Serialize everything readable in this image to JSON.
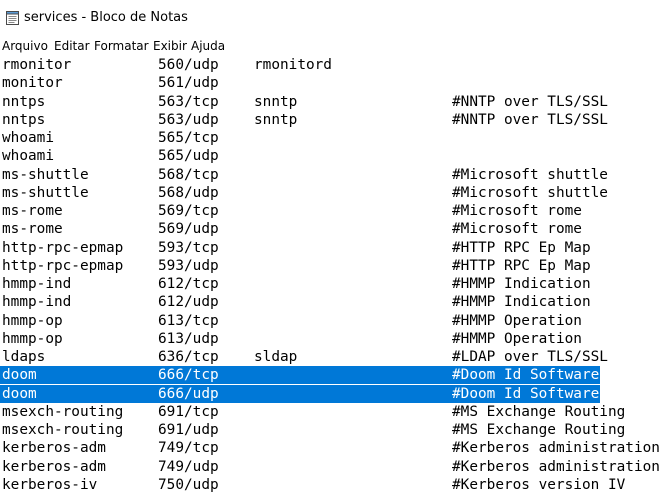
{
  "window": {
    "title": "services - Bloco de Notas"
  },
  "menu": [
    "Arquivo",
    "Editar",
    "Formatar",
    "Exibir",
    "Ajuda"
  ],
  "lines": [
    {
      "name": "rmonitor",
      "port": "560/udp",
      "alias": "rmonitord",
      "comment": ""
    },
    {
      "name": "monitor",
      "port": "561/udp",
      "alias": "",
      "comment": ""
    },
    {
      "name": "nntps",
      "port": "563/tcp",
      "alias": "snntp",
      "comment": "#NNTP over TLS/SSL"
    },
    {
      "name": "nntps",
      "port": "563/udp",
      "alias": "snntp",
      "comment": "#NNTP over TLS/SSL"
    },
    {
      "name": "whoami",
      "port": "565/tcp",
      "alias": "",
      "comment": ""
    },
    {
      "name": "whoami",
      "port": "565/udp",
      "alias": "",
      "comment": ""
    },
    {
      "name": "ms-shuttle",
      "port": "568/tcp",
      "alias": "",
      "comment": "#Microsoft shuttle"
    },
    {
      "name": "ms-shuttle",
      "port": "568/udp",
      "alias": "",
      "comment": "#Microsoft shuttle"
    },
    {
      "name": "ms-rome",
      "port": "569/tcp",
      "alias": "",
      "comment": "#Microsoft rome"
    },
    {
      "name": "ms-rome",
      "port": "569/udp",
      "alias": "",
      "comment": "#Microsoft rome"
    },
    {
      "name": "http-rpc-epmap",
      "port": "593/tcp",
      "alias": "",
      "comment": "#HTTP RPC Ep Map"
    },
    {
      "name": "http-rpc-epmap",
      "port": "593/udp",
      "alias": "",
      "comment": "#HTTP RPC Ep Map"
    },
    {
      "name": "hmmp-ind",
      "port": "612/tcp",
      "alias": "",
      "comment": "#HMMP Indication"
    },
    {
      "name": "hmmp-ind",
      "port": "612/udp",
      "alias": "",
      "comment": "#HMMP Indication"
    },
    {
      "name": "hmmp-op",
      "port": "613/tcp",
      "alias": "",
      "comment": "#HMMP Operation"
    },
    {
      "name": "hmmp-op",
      "port": "613/udp",
      "alias": "",
      "comment": "#HMMP Operation"
    },
    {
      "name": "ldaps",
      "port": "636/tcp",
      "alias": "sldap",
      "comment": "#LDAP over TLS/SSL"
    },
    {
      "name": "doom",
      "port": "666/tcp",
      "alias": "",
      "comment": "#Doom Id Software",
      "selected": true
    },
    {
      "name": "doom",
      "port": "666/udp",
      "alias": "",
      "comment": "#Doom Id Software",
      "selected": true
    },
    {
      "name": "msexch-routing",
      "port": "691/tcp",
      "alias": "",
      "comment": "#MS Exchange Routing"
    },
    {
      "name": "msexch-routing",
      "port": "691/udp",
      "alias": "",
      "comment": "#MS Exchange Routing"
    },
    {
      "name": "kerberos-adm",
      "port": "749/tcp",
      "alias": "",
      "comment": "#Kerberos administration"
    },
    {
      "name": "kerberos-adm",
      "port": "749/udp",
      "alias": "",
      "comment": "#Kerberos administration"
    },
    {
      "name": "kerberos-iv",
      "port": "750/udp",
      "alias": "",
      "comment": "#Kerberos version IV"
    }
  ],
  "colors": {
    "selection": "#0078d7",
    "selection_text": "#ffffff",
    "text": "#000000",
    "background": "#ffffff"
  },
  "icons": {
    "app": "notepad-icon"
  }
}
